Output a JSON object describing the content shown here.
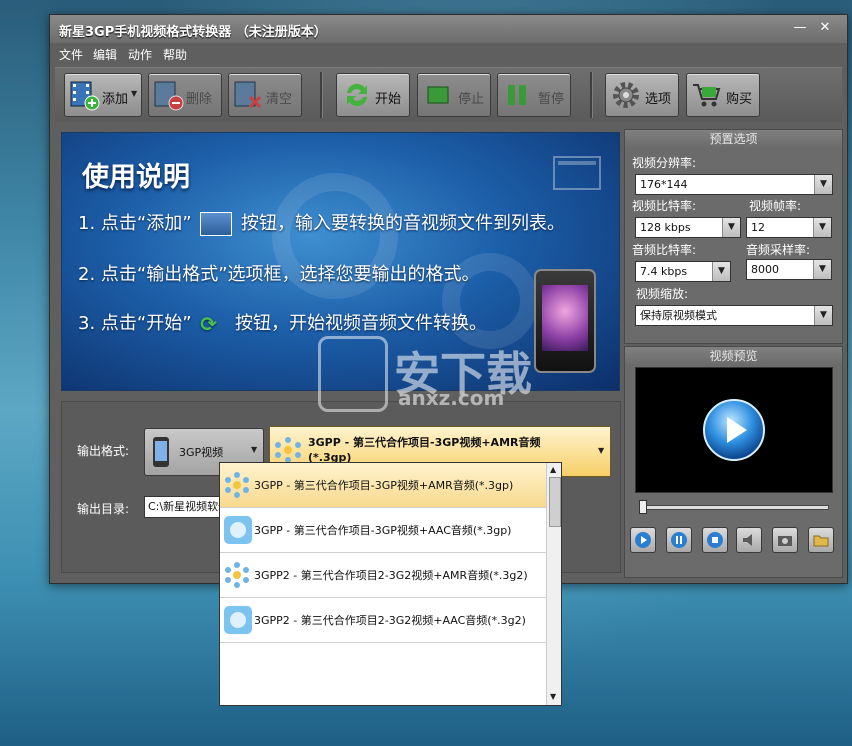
{
  "window": {
    "title": "新星3GP手机视频格式转换器 （未注册版本）"
  },
  "menu": {
    "items": [
      "文件",
      "编辑",
      "动作",
      "帮助"
    ]
  },
  "toolbar": {
    "add": "添加",
    "delete": "删除",
    "clear": "清空",
    "start": "开始",
    "stop": "停止",
    "pause": "暂停",
    "options": "选项",
    "buy": "购买"
  },
  "banner": {
    "title": "使用说明",
    "step1_a": "1. 点击“添加”",
    "step1_b": "按钮，输入要转换的音视频文件到列表。",
    "step2": "2. 点击“输出格式”选项框，选择您要输出的格式。",
    "step3_a": "3. 点击“开始”",
    "step3_b": "按钮，开始视频音频文件转换。"
  },
  "output": {
    "format_label": "输出格式:",
    "device": "3GP视频",
    "format_selected_line1": "3GPP  -  第三代合作项目-3GP视频+AMR音频",
    "format_selected_line2": "(*.3gp)",
    "dir_label": "输出目录:",
    "dir_value": "C:\\新星视频软件\\输出"
  },
  "dropdown": {
    "items": [
      "3GPP - 第三代合作项目-3GP视频+AMR音频(*.3gp)",
      "3GPP - 第三代合作项目-3GP视频+AAC音频(*.3gp)",
      "3GPP2 - 第三代合作项目2-3G2视频+AMR音频(*.3g2)",
      "3GPP2 - 第三代合作项目2-3G2视频+AAC音频(*.3g2)"
    ]
  },
  "presets": {
    "header": "预置选项",
    "resolution_label": "视频分辨率:",
    "resolution": "176*144",
    "vbitrate_label": "视频比特率:",
    "vbitrate": "128 kbps",
    "fps_label": "视频帧率:",
    "fps": "12",
    "abitrate_label": "音频比特率:",
    "abitrate": "7.4 kbps",
    "samplerate_label": "音频采样率:",
    "samplerate": "8000",
    "scale_label": "视频缩放:",
    "scale": "保持原视频模式"
  },
  "preview": {
    "header": "视频预览",
    "position": 0
  },
  "watermark": {
    "text": "安下载",
    "sub": "anxz.com"
  }
}
